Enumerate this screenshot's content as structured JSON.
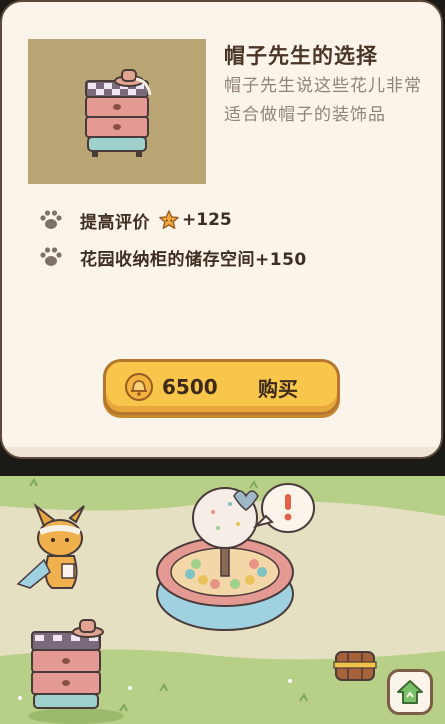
{
  "item": {
    "title": "帽子先生的选择",
    "description": "帽子先生说这些花儿非常适合做帽子的装饰品"
  },
  "bonuses": [
    {
      "label": "提高评价",
      "value": "+125",
      "icon": "paw-icon",
      "value_icon": "star-icon"
    },
    {
      "label": "花园收纳柜的储存空间+150",
      "icon": "paw-icon"
    }
  ],
  "purchase": {
    "price": "6500",
    "currency_icon": "bell-coin-icon",
    "label": "购买"
  },
  "scene": {
    "home_icon": "home-arrow-icon",
    "alert_icon": "exclamation-bubble-icon"
  },
  "colors": {
    "card_bg": "#fbf4ea",
    "button": "#f7c64b",
    "grass": "#b7cf86",
    "path": "#e6e0c2"
  }
}
